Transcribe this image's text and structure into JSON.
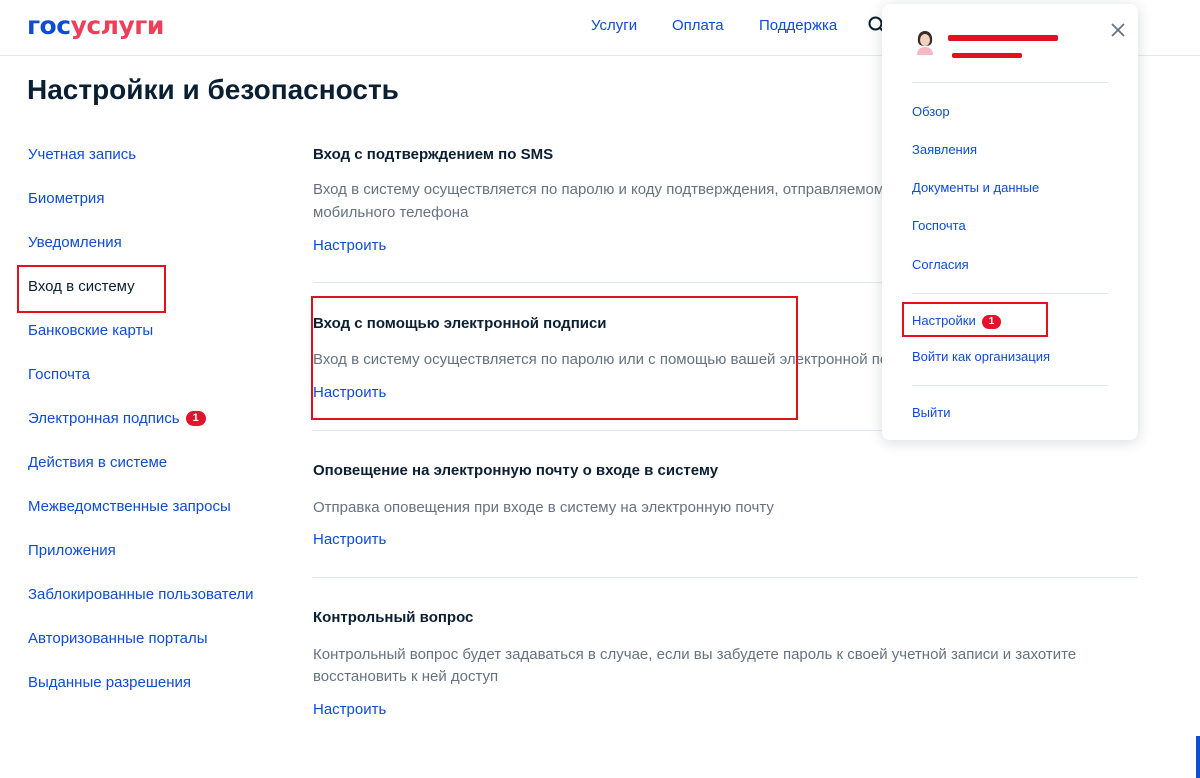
{
  "header": {
    "logo_part1": "гос",
    "logo_part2": "услуги",
    "nav": [
      "Услуги",
      "Оплата",
      "Поддержка"
    ]
  },
  "page": {
    "title": "Настройки и безопасность"
  },
  "sidebar": {
    "items": [
      {
        "label": "Учетная запись"
      },
      {
        "label": "Биометрия"
      },
      {
        "label": "Уведомления"
      },
      {
        "label": "Вход в систему"
      },
      {
        "label": "Банковские карты"
      },
      {
        "label": "Госпочта"
      },
      {
        "label": "Электронная подпись",
        "badge": "1"
      },
      {
        "label": "Действия в системе"
      },
      {
        "label": "Межведомственные запросы"
      },
      {
        "label": "Приложения"
      },
      {
        "label": "Заблокированные пользователи"
      },
      {
        "label": "Авторизованные порталы"
      },
      {
        "label": "Выданные разрешения"
      }
    ]
  },
  "sections": [
    {
      "title": "Вход с подтверждением по SMS",
      "desc_line1": "Вход в систему осуществляется по паролю и коду подтверждения, отправляемому н",
      "desc_line2": "мобильного телефона",
      "link": "Настроить"
    },
    {
      "title": "Вход с помощью электронной подписи",
      "desc_line1": "Вход в систему осуществляется по паролю или с помощью вашей электронной подп",
      "link": "Настроить"
    },
    {
      "title": "Оповещение на электронную почту о входе в систему",
      "desc_line1": "Отправка оповещения при входе в систему на электронную почту",
      "link": "Настроить"
    },
    {
      "title": "Контрольный вопрос",
      "desc_line1": "Контрольный вопрос будет задаваться в случае, если вы забудете пароль к своей учетной записи и захотите",
      "desc_line2": "восстановить к ней доступ",
      "link": "Настроить"
    }
  ],
  "dropdown": {
    "items": [
      "Обзор",
      "Заявления",
      "Документы и данные",
      "Госпочта",
      "Согласия"
    ],
    "settings_label": "Настройки",
    "settings_badge": "1",
    "org_label": "Войти как организация",
    "logout_label": "Выйти"
  },
  "colors": {
    "link": "#0d4cd3",
    "text": "#0b1f33",
    "muted": "#66727f",
    "badge": "#e1132f",
    "highlight": "#e0121e"
  }
}
